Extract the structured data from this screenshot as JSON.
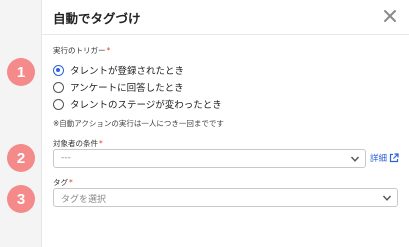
{
  "panel": {
    "title": "自動でタグづけ",
    "close_icon": "close-icon"
  },
  "steps": [
    "1",
    "2",
    "3"
  ],
  "trigger": {
    "label": "実行のトリガー",
    "required_mark": "*",
    "options": [
      {
        "label": "タレントが登録されたとき",
        "selected": true
      },
      {
        "label": "アンケートに回答したとき",
        "selected": false
      },
      {
        "label": "タレントのステージが変わったとき",
        "selected": false
      }
    ],
    "note": "※自動アクションの実行は一人につき一回までです"
  },
  "condition": {
    "label": "対象者の条件",
    "required_mark": "*",
    "value": "---",
    "detail_link": "詳細"
  },
  "tag": {
    "label": "タグ",
    "required_mark": "*",
    "placeholder": "タグを選択"
  },
  "colors": {
    "accent": "#2b63d9",
    "badge": "#f58a8a",
    "required": "#e0433a"
  }
}
